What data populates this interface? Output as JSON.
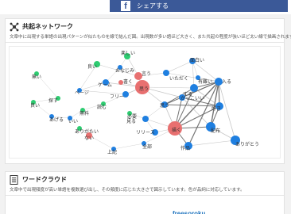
{
  "share": {
    "label": "シェアする",
    "logo": "f"
  },
  "network": {
    "title": "共起ネットワーク",
    "description": "文章中に出現する単語の出現パターンが似たものを線で結んだ図。出現数が多い語ほど大きく、また共起の程度が強いほど太い線で描画されます。",
    "labels": [
      "楽しい",
      "良い",
      "無い",
      "言う",
      "いただく",
      "思う",
      "面白い",
      "書く",
      "ゲーム",
      "ページ",
      "する",
      "入る",
      "フリー",
      "探す",
      "かっこいい",
      "リリース",
      "思う",
      "描く",
      "良い",
      "無料",
      "読む",
      "必要",
      "ありがたい",
      "見る",
      "好き",
      "作品",
      "配布",
      "ありがとう",
      "上記",
      "ない",
      "あげる",
      "いい",
      "全部",
      "おなじみ",
      "有難い"
    ]
  },
  "wordcloud": {
    "title": "ワードクラウド",
    "description": "文章中で出現頻度が高い単語を複数選び出し、その頻度に応じた大きさで図示しています。色が品詞に対応しています。",
    "logo_text": "freesoroku"
  },
  "colors": {
    "facebook": "#3b5998",
    "verb": "#e87070",
    "noun": "#1f7fe0",
    "adjective": "#2ecc71",
    "edge": "#999999"
  }
}
